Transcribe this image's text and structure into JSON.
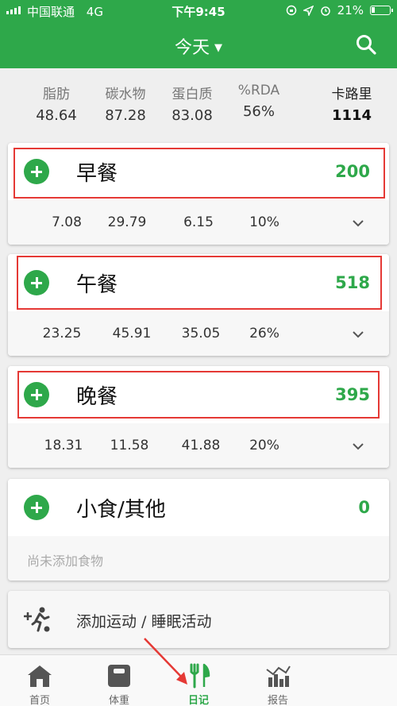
{
  "status_bar": {
    "carrier": "中国联通",
    "network": "4G",
    "time": "下午9:45",
    "battery": "21%",
    "battery_level": 0.21
  },
  "header": {
    "title": "今天"
  },
  "summary": {
    "labels": {
      "fat": "脂肪",
      "carbs": "碳水物",
      "protein": "蛋白质",
      "rda": "%RDA",
      "calories": "卡路里"
    },
    "values": {
      "fat": "48.64",
      "carbs": "87.28",
      "protein": "83.08",
      "rda": "56%",
      "calories": "1114"
    }
  },
  "meals": [
    {
      "name": "早餐",
      "calories": "200",
      "fat": "7.08",
      "carbs": "29.79",
      "protein": "6.15",
      "rda": "10%"
    },
    {
      "name": "午餐",
      "calories": "518",
      "fat": "23.25",
      "carbs": "45.91",
      "protein": "35.05",
      "rda": "26%"
    },
    {
      "name": "晚餐",
      "calories": "395",
      "fat": "18.31",
      "carbs": "11.58",
      "protein": "41.88",
      "rda": "20%"
    },
    {
      "name": "小食/其他",
      "calories": "0",
      "empty_text": "尚未添加食物"
    }
  ],
  "exercise": {
    "label": "添加运动 / 睡眠活动"
  },
  "tabs": [
    {
      "label": "首页",
      "icon": "home-icon"
    },
    {
      "label": "体重",
      "icon": "scale-icon"
    },
    {
      "label": "日记",
      "icon": "fork-knife-icon",
      "active": true
    },
    {
      "label": "报告",
      "icon": "report-chart-icon"
    }
  ],
  "colors": {
    "brand_green": "#2ea84a",
    "highlight_red": "#e53935"
  }
}
